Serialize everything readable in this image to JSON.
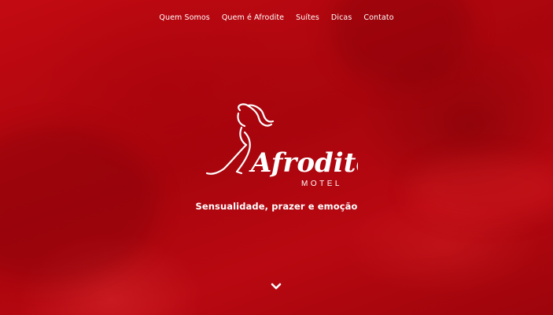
{
  "nav": {
    "items": [
      {
        "label": "Quem Somos"
      },
      {
        "label": "Quem é Afrodite"
      },
      {
        "label": "Suítes"
      },
      {
        "label": "Dicas"
      },
      {
        "label": "Contato"
      }
    ]
  },
  "brand": {
    "name": "Afrodite",
    "subtitle": "MOTEL",
    "tagline": "Sensualidade, prazer e emoção"
  },
  "icons": {
    "scroll": "chevron-down-icon",
    "logo_figure": "woman-silhouette-icon"
  },
  "colors": {
    "background": "#b0050b",
    "text": "#ffffff"
  }
}
